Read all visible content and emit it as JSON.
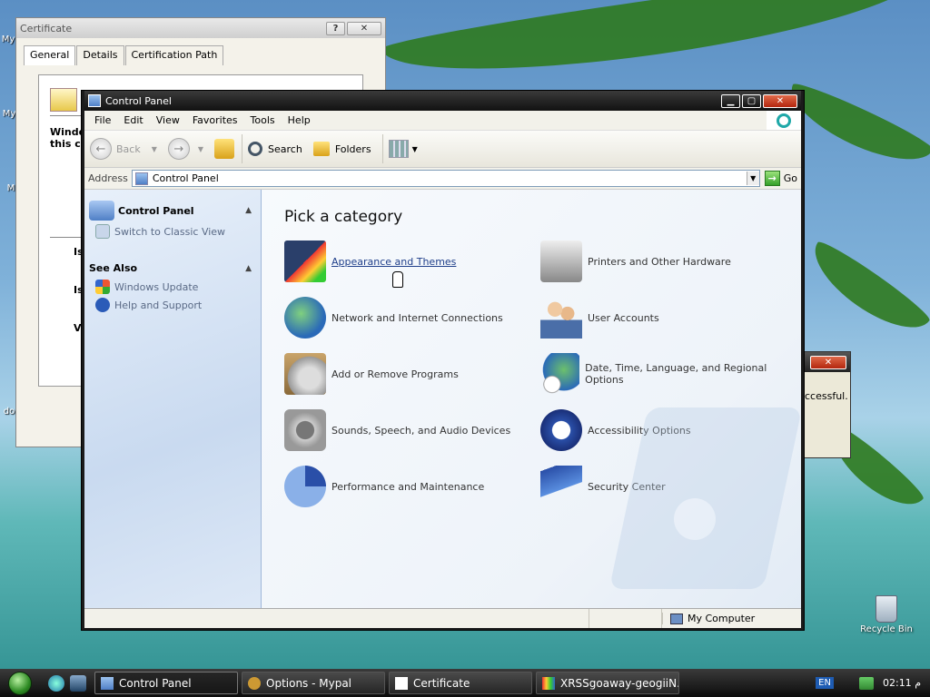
{
  "desktop": {
    "recycle_bin_label": "Recycle Bin",
    "left_icon_labels": [
      "My",
      "My",
      "M",
      "do"
    ]
  },
  "certificate_window": {
    "title": "Certificate",
    "help_btn": "?",
    "close_btn": "✕",
    "tabs": [
      "General",
      "Details",
      "Certification Path"
    ],
    "text_line1": "Windo",
    "text_line2": "this ce",
    "side_letters": [
      "Is",
      "Is",
      "V"
    ]
  },
  "background_dialog": {
    "close_btn": "✕",
    "text": "ccessful."
  },
  "control_panel": {
    "title": "Control Panel",
    "min_btn": "▁",
    "max_btn": "▢",
    "close_btn": "✕",
    "menu": [
      "File",
      "Edit",
      "View",
      "Favorites",
      "Tools",
      "Help"
    ],
    "toolbar": {
      "back": "Back",
      "search": "Search",
      "folders": "Folders"
    },
    "address": {
      "label": "Address",
      "value": "Control Panel",
      "go": "Go"
    },
    "sidebar": {
      "panel_title": "Control Panel",
      "switch_view": "Switch to Classic View",
      "see_also": "See Also",
      "links": [
        "Windows Update",
        "Help and Support"
      ]
    },
    "heading": "Pick a category",
    "categories": [
      "Appearance and Themes",
      "Printers and Other Hardware",
      "Network and Internet Connections",
      "User Accounts",
      "Add or Remove Programs",
      "Date, Time, Language, and Regional Options",
      "Sounds, Speech, and Audio Devices",
      "Accessibility Options",
      "Performance and Maintenance",
      "Security Center"
    ],
    "status": {
      "location": "My Computer"
    }
  },
  "taskbar": {
    "tasks": [
      "Control Panel",
      "Options - Mypal",
      "Certificate",
      "XRSSgoaway-geogiiN..."
    ],
    "lang": "EN",
    "clock": "02:11 م"
  },
  "colors": {
    "cp_sidebar": "#c9daf0",
    "link_hover": "#1f3f8a",
    "taskbar": "#0c0c0c"
  }
}
